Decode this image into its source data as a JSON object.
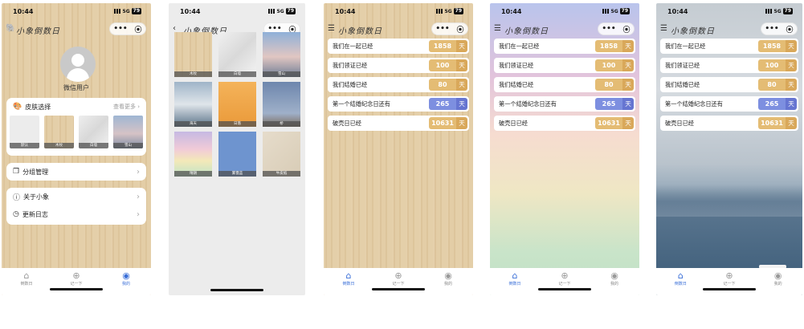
{
  "status": {
    "time": "10:44",
    "network": "5G",
    "battery": "79"
  },
  "app_title": "小象倒数日",
  "capsule": {
    "more": "•••",
    "close": "⦿"
  },
  "profile": {
    "username": "微信用户"
  },
  "skin_section": {
    "title": "皮肤选择",
    "more": "查看更多",
    "items": [
      "默认",
      "木纹",
      "白墙",
      "雪山"
    ]
  },
  "menu": {
    "group": "分组管理",
    "about": "关于小象",
    "changelog": "更新日志"
  },
  "gallery": [
    "木纹",
    "白墙",
    "雪山",
    "海天",
    "日落",
    "桥",
    "晴朗",
    "雾霭蓝",
    "牛皮纸"
  ],
  "countdown_items": [
    {
      "label": "我们在一起已经",
      "value": "1858",
      "unit": "天",
      "color": "#e4bc74"
    },
    {
      "label": "我们领证已经",
      "value": "100",
      "unit": "天",
      "color": "#e4bc74"
    },
    {
      "label": "我们结婚已经",
      "value": "80",
      "unit": "天",
      "color": "#e4bc74"
    },
    {
      "label": "第一个结婚纪念日还有",
      "value": "265",
      "unit": "天",
      "color": "#7d8fe0"
    },
    {
      "label": "破壳日已经",
      "value": "10631",
      "unit": "天",
      "color": "#e4bc74"
    }
  ],
  "tabs": {
    "countdown": "倒数日",
    "record": "记一下",
    "mine": "我的"
  },
  "colors": {
    "accent": "#3a6fd8",
    "day_past": "#e4bc74",
    "day_future": "#7d8fe0"
  }
}
